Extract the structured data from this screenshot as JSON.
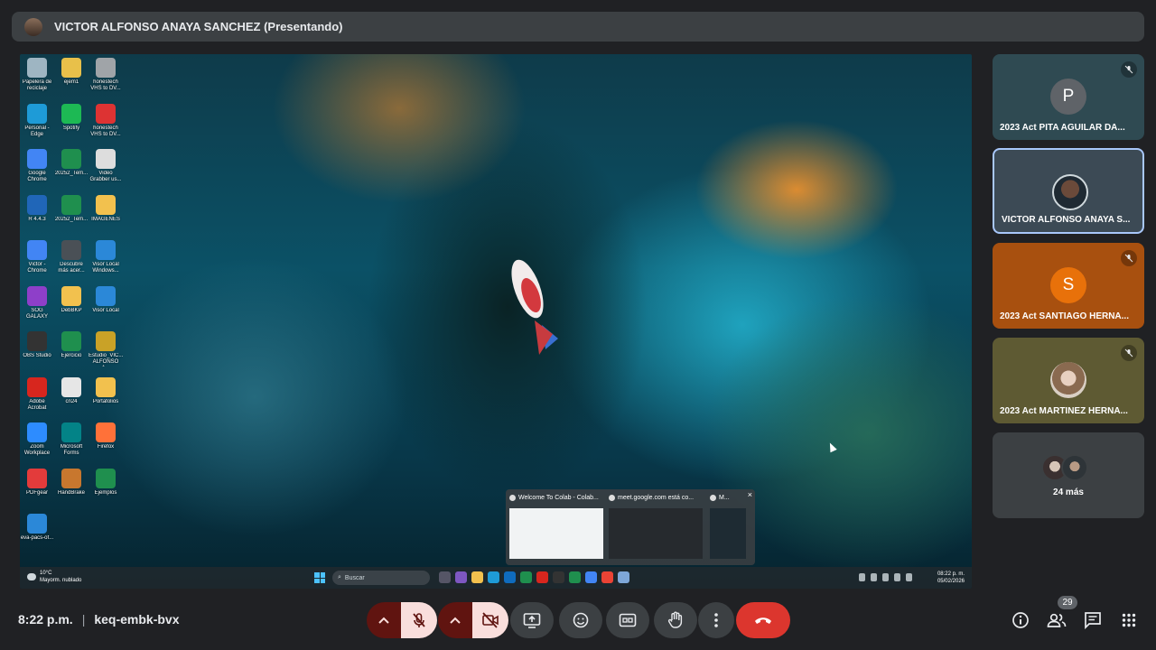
{
  "presenter": {
    "title": "VICTOR ALFONSO ANAYA SANCHEZ (Presentando)"
  },
  "desktop": {
    "icons": [
      {
        "label": "Papelera de reciclaje",
        "color": "#9eb5c2"
      },
      {
        "label": "ejem1",
        "color": "#e8c04a"
      },
      {
        "label": "honestech VHS to DV...",
        "color": "#a0a4a8"
      },
      {
        "label": "Personal - Edge",
        "color": "#1e9bd7"
      },
      {
        "label": "Spotify",
        "color": "#1db954"
      },
      {
        "label": "honestech VHS to DV...",
        "color": "#d33"
      },
      {
        "label": "Google Chrome",
        "color": "#4285f4"
      },
      {
        "label": "20252_Tem...",
        "color": "#1f8f4e"
      },
      {
        "label": "Video Grabber us...",
        "color": "#ddd"
      },
      {
        "label": "R 4.4.3",
        "color": "#2066b8"
      },
      {
        "label": "20252_Tem...",
        "color": "#1f8f4e"
      },
      {
        "label": "IMAGENES",
        "color": "#f2c14e"
      },
      {
        "label": "Victor - Chrome",
        "color": "#4285f4"
      },
      {
        "label": "Descubre más acer...",
        "color": "#4a5056"
      },
      {
        "label": "Visor Local Windows...",
        "color": "#2b88d8"
      },
      {
        "label": "SOG GALAXY",
        "color": "#8e3fc9"
      },
      {
        "label": "DebBKP",
        "color": "#f2c14e"
      },
      {
        "label": "Visor Local",
        "color": "#2b88d8"
      },
      {
        "label": "OBS Studio",
        "color": "#333"
      },
      {
        "label": "Ejercicio",
        "color": "#1f8f4e"
      },
      {
        "label": "Estudio_VIC... ALFONSO A...",
        "color": "#c9a227"
      },
      {
        "label": "Adobe Acrobat",
        "color": "#d7261e"
      },
      {
        "label": "cn24",
        "color": "#e6e6e6"
      },
      {
        "label": "Portafolios",
        "color": "#f2c14e"
      },
      {
        "label": "Zoom Workplace",
        "color": "#2d8cff"
      },
      {
        "label": "Microsoft Forms",
        "color": "#038387"
      },
      {
        "label": "Firefox",
        "color": "#ff7139"
      },
      {
        "label": "PDFgear",
        "color": "#e33b3b"
      },
      {
        "label": "HandBrake",
        "color": "#c8772e"
      },
      {
        "label": "Ejemplos",
        "color": "#1f8f4e"
      },
      {
        "label": "eva-pacs-of...",
        "color": "#2b88d8"
      }
    ],
    "taskbar": {
      "weather_temp": "10°C",
      "weather_desc": "Mayorm. nublado",
      "search_placeholder": "Buscar",
      "time": "08:22 p. m.",
      "date": "05/02/2026"
    },
    "thumbnails": [
      {
        "title": "Welcome To Colab - Colab..."
      },
      {
        "title": "meet.google.com está co..."
      },
      {
        "title": "M..."
      }
    ],
    "thumb_close": "×"
  },
  "participants": [
    {
      "name": "2023 Act PITA AGUILAR DA...",
      "initial": "P",
      "initial_bg": "#5f6368",
      "tile_bg": "#2f4a52",
      "muted": true,
      "active": false
    },
    {
      "name": "VICTOR ALFONSO ANAYA S...",
      "initial": "",
      "initial_bg": "#6b7b86",
      "tile_bg": "#3c4a55",
      "muted": false,
      "active": true
    },
    {
      "name": "2023 Act SANTIAGO HERNA...",
      "initial": "S",
      "initial_bg": "#e8710a",
      "tile_bg": "#a8500f",
      "muted": true,
      "active": false
    },
    {
      "name": "2023 Act MARTINEZ HERNA...",
      "initial": "",
      "initial_bg": "#c9b8a8",
      "tile_bg": "#5e5a33",
      "muted": true,
      "active": false
    }
  ],
  "more": {
    "label": "24 más"
  },
  "meeting": {
    "time": "8:22 p.m.",
    "separator": "|",
    "code": "keq-embk-bvx",
    "participant_count": "29"
  }
}
